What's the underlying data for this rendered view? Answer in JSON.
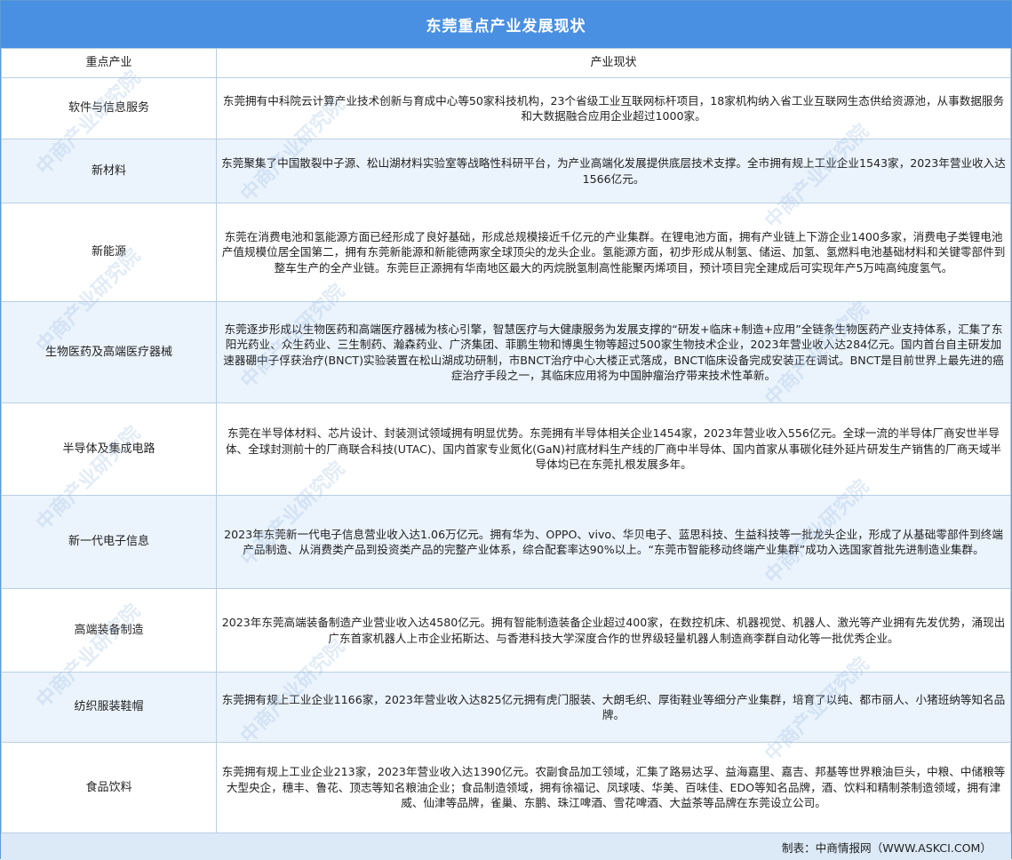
{
  "title": "东莞重点产业发展现状",
  "headers": {
    "industry": "重点产业",
    "status": "产业现状"
  },
  "rows": [
    {
      "industry": "软件与信息服务",
      "status": "东莞拥有中科院云计算产业技术创新与育成中心等50家科技机构，23个省级工业互联网标杆项目，18家机构纳入省工业互联网生态供给资源池，从事数据服务和大数据融合应用企业超过1000家。"
    },
    {
      "industry": "新材料",
      "status": "东莞聚集了中国散裂中子源、松山湖材料实验室等战略性科研平台，为产业高端化发展提供底层技术支撑。全市拥有规上工业企业1543家，2023年营业收入达1566亿元。"
    },
    {
      "industry": "新能源",
      "status": "东莞在消费电池和氢能源方面已经形成了良好基础，形成总规模接近千亿元的产业集群。在锂电池方面，拥有产业链上下游企业1400多家，消费电子类锂电池产值规模位居全国第二，拥有东莞新能源和新能德两家全球顶尖的龙头企业。氢能源方面，初步形成从制氢、储运、加氢、氢燃料电池基础材料和关键零部件到整车生产的全产业链。东莞巨正源拥有华南地区最大的丙烷脱氢制高性能聚丙烯项目，预计项目完全建成后可实现年产5万吨高纯度氢气。"
    },
    {
      "industry": "生物医药及高端医疗器械",
      "status": "东莞逐步形成以生物医药和高端医疗器械为核心引擎，智慧医疗与大健康服务为发展支撑的“研发+临床+制造+应用”全链条生物医药产业支持体系，汇集了东阳光药业、众生药业、三生制药、瀚森药业、广济集团、菲鹏生物和博奥生物等超过500家生物技术企业，2023年营业收入达284亿元。国内首台自主研发加速器硼中子俘获治疗(BNCT)实验装置在松山湖成功研制，市BNCT治疗中心大楼正式落成，BNCT临床设备完成安装正在调试。BNCT是目前世界上最先进的癌症治疗手段之一，其临床应用将为中国肿瘤治疗带来技术性革新。"
    },
    {
      "industry": "半导体及集成电路",
      "status": "东莞在半导体材料、芯片设计、封装测试领域拥有明显优势。东莞拥有半导体相关企业1454家，2023年营业收入556亿元。全球一流的半导体厂商安世半导体、全球封测前十的厂商联合科技(UTAC)、国内首家专业氮化(GaN)衬底材料生产线的厂商中半导体、国内首家从事碳化硅外延片研发生产销售的厂商天域半导体均已在东莞扎根发展多年。"
    },
    {
      "industry": "新一代电子信息",
      "status": "2023年东莞新一代电子信息营业收入达1.06万亿元。拥有华为、OPPO、vivo、华贝电子、蓝思科技、生益科技等一批龙头企业，形成了从基础零部件到终端产品制造、从消费类产品到投资类产品的完整产业体系，综合配套率达90%以上。“东莞市智能移动终端产业集群”成功入选国家首批先进制造业集群。"
    },
    {
      "industry": "高端装备制造",
      "status": "2023年东莞高端装备制造产业营业收入达4580亿元。拥有智能制造装备企业超过400家，在数控机床、机器视觉、机器人、激光等产业拥有先发优势，涌现出广东首家机器人上市企业拓斯达、与香港科技大学深度合作的世界级轻量机器人制造商李群自动化等一批优秀企业。"
    },
    {
      "industry": "纺织服装鞋帽",
      "status": "东莞拥有规上工业企业1166家，2023年营业收入达825亿元拥有虎门服装、大朗毛织、厚街鞋业等细分产业集群，培育了以纯、都市丽人、小猪班纳等知名品牌。"
    },
    {
      "industry": "食品饮料",
      "status": "东莞拥有规上工业企业213家，2023年营业收入达1390亿元。农副食品加工领域，汇集了路易达孚、益海嘉里、嘉吉、邦基等世界粮油巨头，中粮、中储粮等大型央企，穗丰、鲁花、顶志等知名粮油企业；食品制造领域，拥有徐福记、凤球唛、华美、百味佳、EDO等知名品牌，酒、饮料和精制茶制造领域，拥有津威、仙津等品牌，雀巢、东鹏、珠江啤酒、雪花啤酒、大益茶等品牌在东莞设立公司。"
    }
  ],
  "footer": "制表：中商情报网（WWW.ASKCI.COM）",
  "watermark": "中商产业研究院",
  "colors": {
    "title_bg": "#4a90e2",
    "alt_row_bg": "#ebf3fc",
    "footer_bg": "#dce9f7"
  }
}
